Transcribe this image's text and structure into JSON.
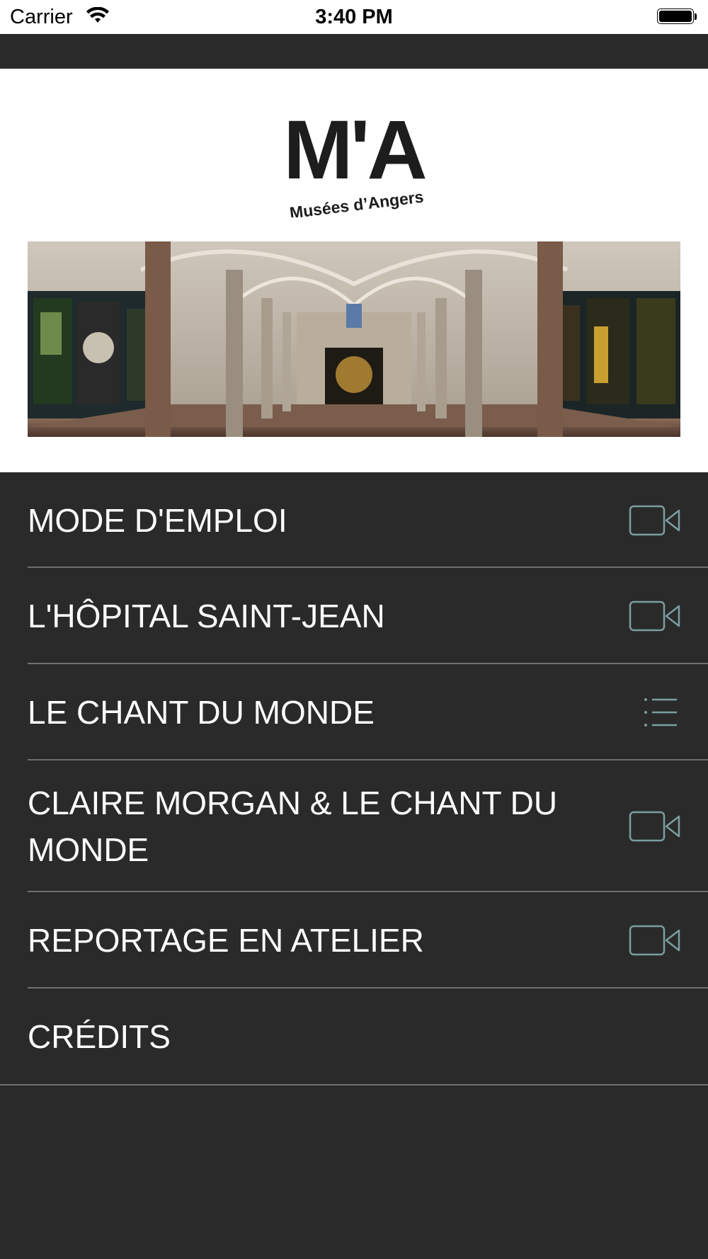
{
  "status_bar": {
    "carrier": "Carrier",
    "time": "3:40 PM"
  },
  "logo": {
    "mark": "M'A",
    "subtitle": "Musées d’Angers"
  },
  "hero": {
    "description_icon": "museum-hall-image"
  },
  "menu": {
    "items": [
      {
        "label": "MODE D'EMPLOI",
        "icon": "video-icon"
      },
      {
        "label": "L'HÔPITAL SAINT-JEAN",
        "icon": "video-icon"
      },
      {
        "label": "LE CHANT DU MONDE",
        "icon": "list-icon"
      },
      {
        "label": "CLAIRE MORGAN & LE CHANT DU MONDE",
        "icon": "video-icon"
      },
      {
        "label": "REPORTAGE EN ATELIER",
        "icon": "video-icon"
      },
      {
        "label": "CRÉDITS",
        "icon": ""
      }
    ]
  },
  "colors": {
    "background": "#2a2a2a",
    "divider": "#6f6f6f",
    "icon": "#7b9ea0"
  }
}
